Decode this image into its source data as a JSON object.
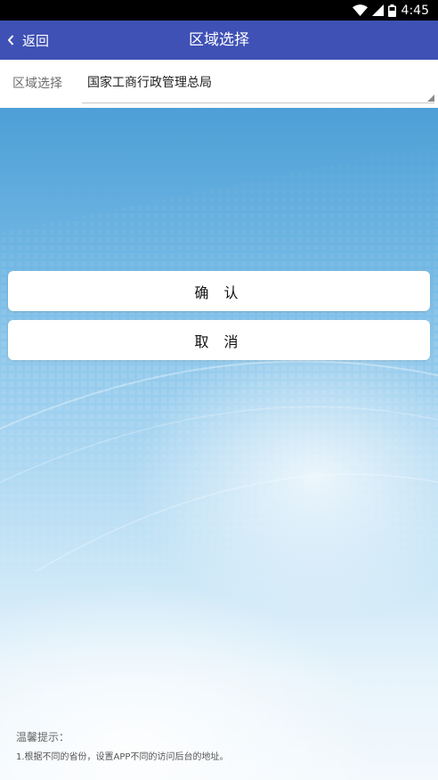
{
  "status_bar": {
    "time": "4:45",
    "icons": [
      "wifi-icon",
      "signal-icon",
      "battery-icon"
    ]
  },
  "header": {
    "back_label": "返回",
    "title": "区域选择"
  },
  "region": {
    "label": "区域选择",
    "selected_value": "国家工商行政管理总局"
  },
  "buttons": {
    "confirm_label": "确 认",
    "cancel_label": "取 消"
  },
  "tips": {
    "title": "温馨提示：",
    "items": [
      "1.根据不同的省份，设置APP不同的访问后台的地址。"
    ]
  },
  "colors": {
    "header_bg": "#3f51b5",
    "status_bar_bg": "#000000",
    "button_bg": "#ffffff"
  }
}
